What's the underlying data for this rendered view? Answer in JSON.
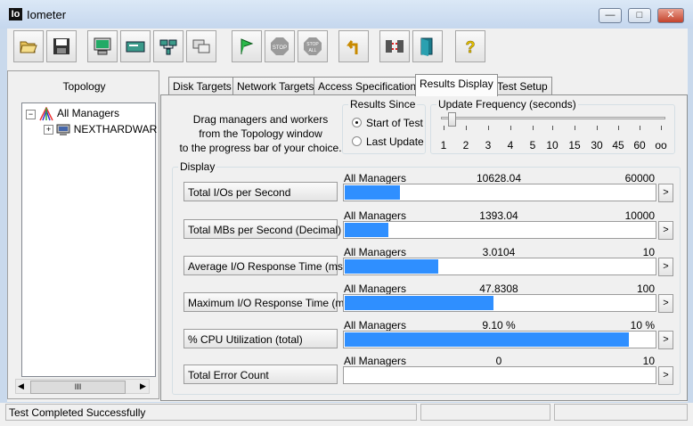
{
  "window": {
    "icon_text": "Io",
    "title": "Iometer",
    "minimize": "—",
    "maximize": "□",
    "close": "✕"
  },
  "toolbar": {
    "buttons": [
      {
        "name": "open-config-icon"
      },
      {
        "name": "save-config-icon"
      },
      {
        "name": "start-display-icon"
      },
      {
        "name": "new-disk-worker-icon"
      },
      {
        "name": "new-network-worker-icon"
      },
      {
        "name": "duplicate-worker-icon"
      },
      {
        "name": "start-tests-icon"
      },
      {
        "name": "stop-icon",
        "label": "STOP"
      },
      {
        "name": "stop-all-icon",
        "label": "STOP ALL"
      },
      {
        "name": "reset-workers-icon"
      },
      {
        "name": "disconnect-icon"
      },
      {
        "name": "exit-icon"
      },
      {
        "name": "help-icon",
        "label": "?"
      }
    ]
  },
  "topology": {
    "title": "Topology",
    "tree": {
      "root": "All Managers",
      "child": "NEXTHARDWAR"
    },
    "scroll_thumb": "III"
  },
  "tabs": [
    {
      "label": "Disk Targets"
    },
    {
      "label": "Network Targets"
    },
    {
      "label": "Access Specifications"
    },
    {
      "label": "Results Display",
      "active": true
    },
    {
      "label": "Test Setup"
    }
  ],
  "results_display": {
    "instructions": [
      "Drag managers and workers",
      "from the Topology window",
      "to the progress bar of your choice."
    ],
    "results_since": {
      "legend": "Results Since",
      "options": [
        "Start of Test",
        "Last Update"
      ],
      "selected": "Start of Test"
    },
    "update_frequency": {
      "legend": "Update Frequency (seconds)",
      "ticks": [
        "1",
        "2",
        "3",
        "4",
        "5",
        "10",
        "15",
        "30",
        "45",
        "60",
        "oo"
      ],
      "selected": "1"
    },
    "display_legend": "Display",
    "rows": [
      {
        "metric": "Total I/Os per Second",
        "manager": "All Managers",
        "value": "10628.04",
        "max": "60000",
        "fraction": 0.177
      },
      {
        "metric": "Total MBs per Second (Decimal)",
        "manager": "All Managers",
        "value": "1393.04",
        "max": "10000",
        "fraction": 0.139
      },
      {
        "metric": "Average I/O Response Time (ms)",
        "manager": "All Managers",
        "value": "3.0104",
        "max": "10",
        "fraction": 0.301
      },
      {
        "metric": "Maximum I/O Response Time (ms)",
        "manager": "All Managers",
        "value": "47.8308",
        "max": "100",
        "fraction": 0.478
      },
      {
        "metric": "% CPU Utilization (total)",
        "manager": "All Managers",
        "value": "9.10 %",
        "max": "10 %",
        "fraction": 0.91
      },
      {
        "metric": "Total Error Count",
        "manager": "All Managers",
        "value": "0",
        "max": "10",
        "fraction": 0
      }
    ],
    "arrow": ">"
  },
  "status": {
    "message": "Test Completed Successfully"
  },
  "colors": {
    "bar_fill": "#2f8fff",
    "titlebar": "#c5d7ee"
  }
}
